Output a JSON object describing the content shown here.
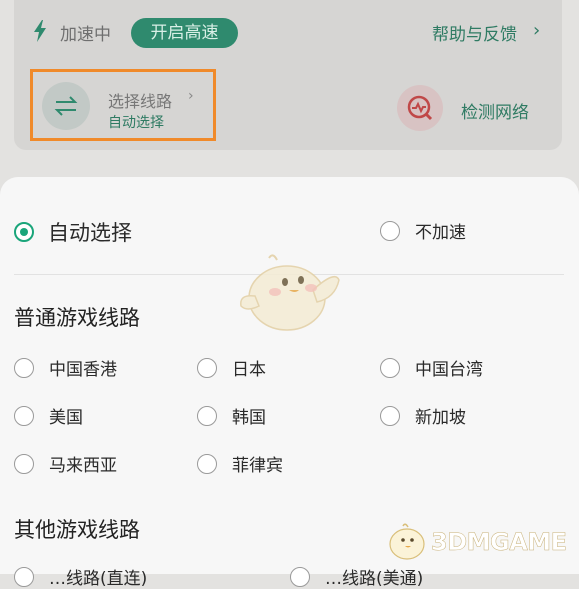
{
  "top": {
    "status": "加速中",
    "boost_button": "开启高速",
    "help": "帮助与反馈",
    "help_chevron": "›",
    "route": {
      "title": "选择线路",
      "chevron": "›",
      "selected": "自动选择"
    },
    "detect": "检测网络"
  },
  "sheet": {
    "auto_option": "自动选择",
    "no_accel_option": "不加速",
    "section_normal": "普通游戏线路",
    "normal_routes": [
      "中国香港",
      "日本",
      "中国台湾",
      "美国",
      "韩国",
      "新加坡",
      "马来西亚",
      "菲律宾"
    ],
    "section_other": "其他游戏线路",
    "other_routes": [
      "…线路(直连)",
      "…线路(美通)"
    ]
  },
  "watermark": "3DMGAME",
  "colors": {
    "accent": "#1aa57a",
    "highlight_border": "#f08a2a"
  }
}
